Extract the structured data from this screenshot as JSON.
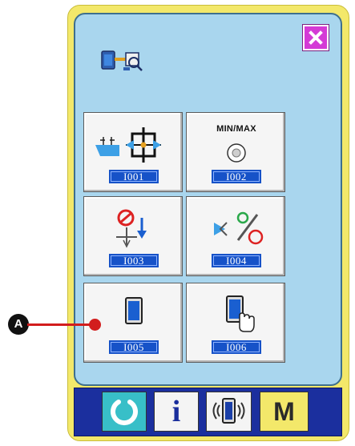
{
  "header": {
    "icon": "data-transfer-search-icon"
  },
  "close_button": {
    "icon": "close-icon",
    "color": "#d43ad6"
  },
  "buttons": [
    {
      "code": "I001",
      "icon": "feed-positioning-icon"
    },
    {
      "code": "I002",
      "label": "MIN/MAX",
      "icon": "min-max-dial-icon"
    },
    {
      "code": "I003",
      "icon": "needle-stop-icon"
    },
    {
      "code": "I004",
      "icon": "ratio-adjust-icon"
    },
    {
      "code": "I005",
      "icon": "display-device-icon"
    },
    {
      "code": "I006",
      "icon": "device-touch-icon"
    }
  ],
  "callout": {
    "label": "A"
  },
  "bottom_bar": {
    "ready": {
      "icon": "ready-arc-icon",
      "color": "#38bfc8"
    },
    "info": {
      "icon": "info-icon",
      "label": "i"
    },
    "communication": {
      "icon": "communication-icon"
    },
    "mode": {
      "label": "M",
      "color": "#f3e86a"
    }
  }
}
